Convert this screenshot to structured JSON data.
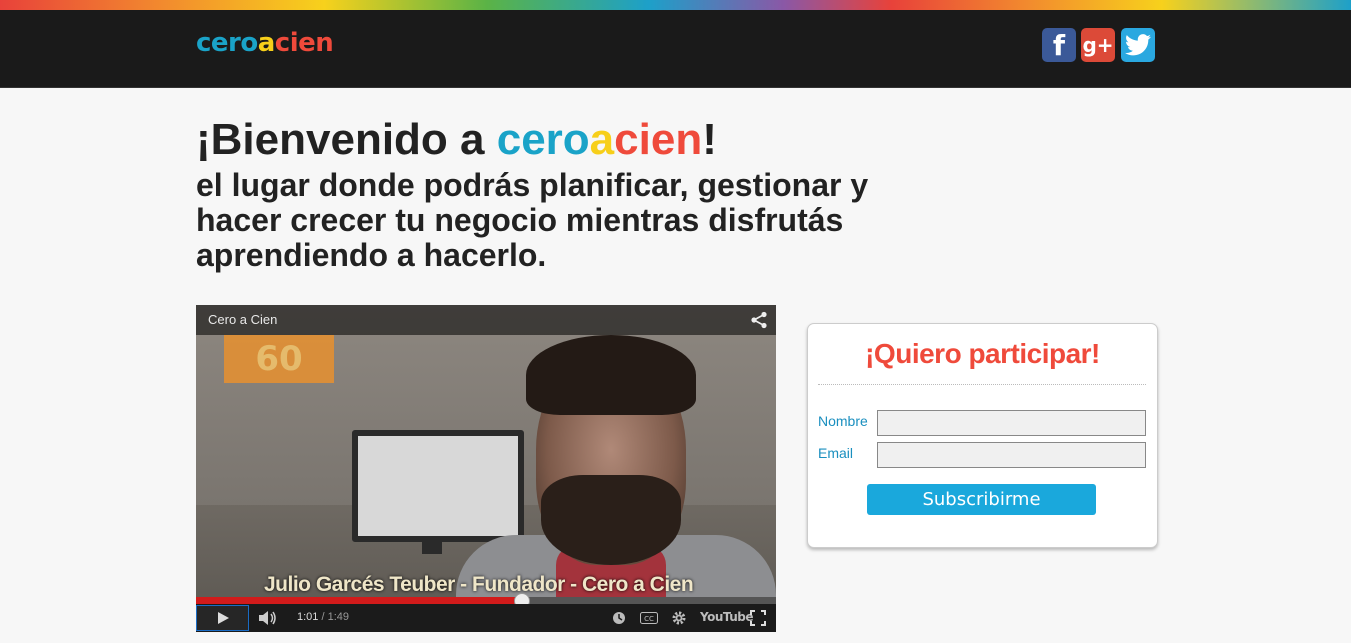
{
  "header": {
    "logo": {
      "part1": "cero",
      "part2": "a",
      "part3": "cien"
    },
    "social": [
      {
        "name": "facebook",
        "glyph": "f"
      },
      {
        "name": "google-plus",
        "glyph": "g+"
      },
      {
        "name": "twitter",
        "glyph": ""
      }
    ]
  },
  "hero": {
    "title_prefix": "¡Bienvenido a ",
    "title_brand1": "cero",
    "title_brand2": "a",
    "title_brand3": "cien",
    "title_suffix": "!",
    "subtitle": "el lugar donde podrás planificar, gestionar y hacer crecer tu negocio mientras disfrutás aprendiendo a hacerlo."
  },
  "video": {
    "title": "Cero a Cien",
    "sign_text": "60",
    "caption": "Julio Garcés Teuber  - Fundador - Cero a Cien",
    "current_time": "1:01",
    "duration": "1:49",
    "progress": 0.56,
    "youtube_label": "YouTube"
  },
  "form": {
    "title": "¡Quiero participar!",
    "name_label": "Nombre",
    "email_label": "Email",
    "name_value": "",
    "email_value": "",
    "submit_label": "Subscribirme"
  },
  "colors": {
    "brand_blue": "#1aa3c8",
    "brand_yellow": "#f7cf1a",
    "brand_red": "#ef4a3b",
    "button": "#1aa8dc"
  }
}
